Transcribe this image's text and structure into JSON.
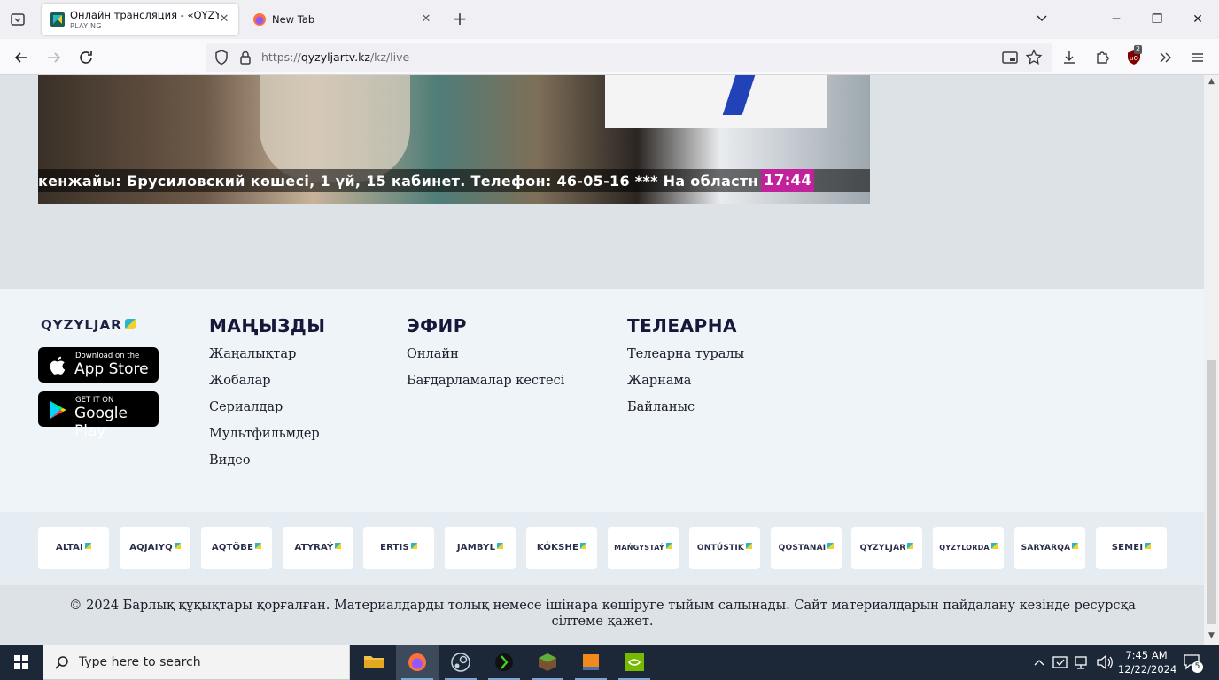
{
  "browser": {
    "tabs": [
      {
        "title": "Онлайн трансляция - «QYZYL",
        "status": "PLAYING"
      },
      {
        "title": "New Tab"
      }
    ],
    "url_prefix": "https://",
    "url_host": "qyzyljartv.kz",
    "url_path": "/kz/live",
    "extension_badge": "2"
  },
  "video": {
    "ticker": "кенжайы: Брусиловский көшесі, 1 үй, 15 кабинет. Телефон: 46-05-16   *** На областн",
    "clock": "17:44"
  },
  "footer": {
    "logo": "QYZYLJAR",
    "app_store": {
      "small": "Download on the",
      "big": "App Store"
    },
    "google_play": {
      "small": "GET IT ON",
      "big": "Google Play"
    },
    "columns": [
      {
        "title": "МАҢЫЗДЫ",
        "links": [
          "Жаңалықтар",
          "Жобалар",
          "Сериалдар",
          "Мультфильмдер",
          "Видео"
        ]
      },
      {
        "title": "ЭФИР",
        "links": [
          "Онлайн",
          "Бағдарламалар кестесі"
        ]
      },
      {
        "title": "ТЕЛЕАРНА",
        "links": [
          "Телеарна туралы",
          "Жарнама",
          "Байланыс"
        ]
      }
    ],
    "channels": [
      "ALTAI",
      "AQJAIYQ",
      "AQTÖBE",
      "ATYRAÝ",
      "ERTIS",
      "JAMBYL",
      "KÓKSHE",
      "MAŃGYSTAÝ",
      "ONTÚSTIK",
      "QOSTANAI",
      "QYZYLJAR",
      "QYZYLORDA",
      "SARYARQA",
      "SEMEI"
    ],
    "copyright": "© 2024 Барлық құқықтары қорғалған. Материалдарды толық немесе ішінара көшіруге тыйым салынады. Сайт материалдарын пайдалану кезінде ресурсқа сілтеме қажет."
  },
  "taskbar": {
    "search_placeholder": "Type here to search",
    "time": "7:45 AM",
    "date": "12/22/2024",
    "notification_count": "5"
  },
  "colors": {
    "accent_magenta": "#c1219a",
    "brand_navy": "#151838",
    "taskbar": "#1c2838"
  }
}
